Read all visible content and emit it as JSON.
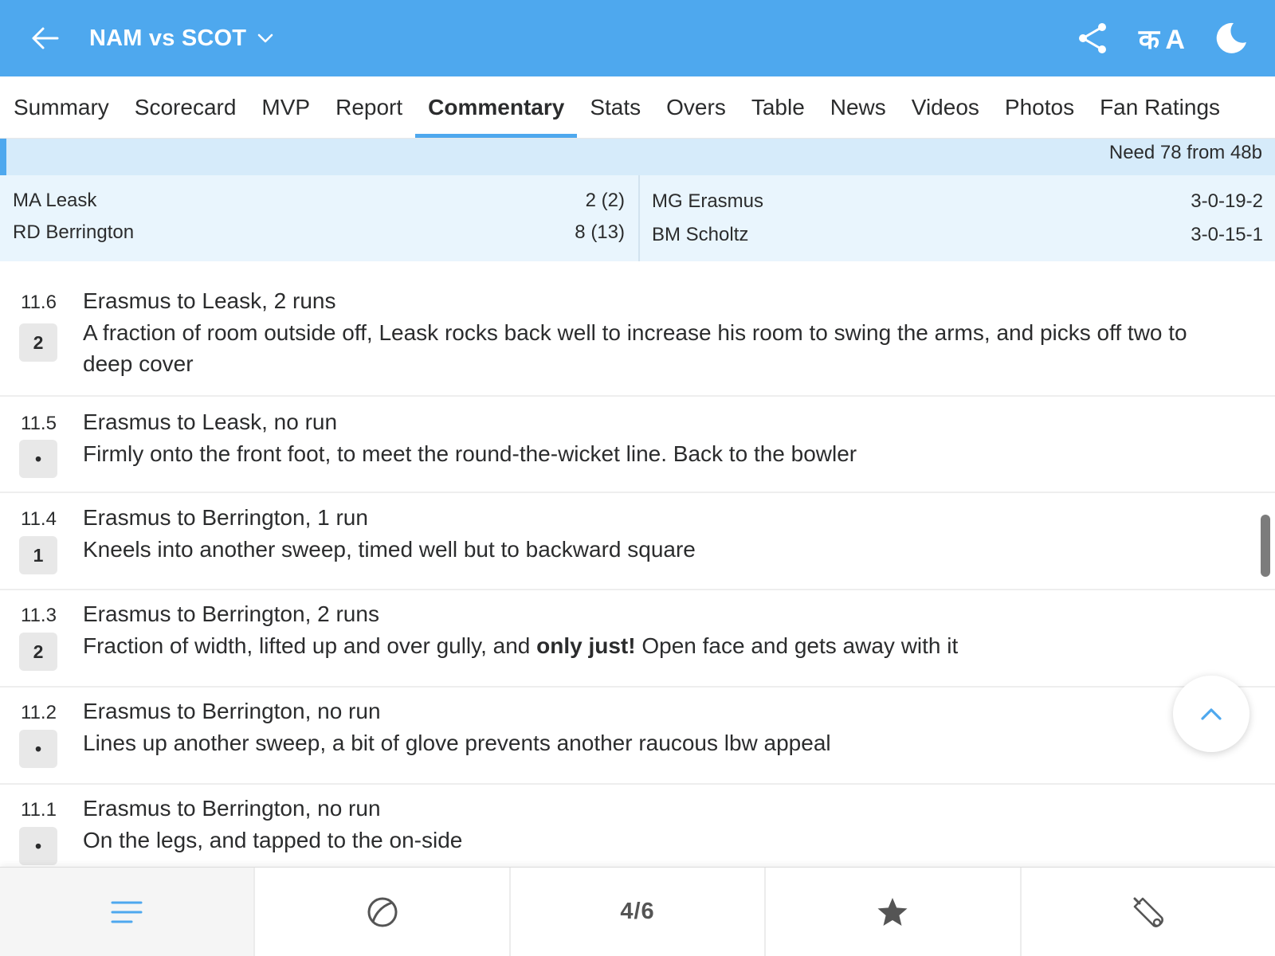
{
  "header": {
    "title": "NAM vs SCOT",
    "lang_label": "क A"
  },
  "tabs": [
    {
      "label": "Summary"
    },
    {
      "label": "Scorecard"
    },
    {
      "label": "MVP"
    },
    {
      "label": "Report"
    },
    {
      "label": "Commentary"
    },
    {
      "label": "Stats"
    },
    {
      "label": "Overs"
    },
    {
      "label": "Table"
    },
    {
      "label": "News"
    },
    {
      "label": "Videos"
    },
    {
      "label": "Photos"
    },
    {
      "label": "Fan Ratings"
    }
  ],
  "active_tab": "Commentary",
  "need": "Need 78 from 48b",
  "batters": [
    {
      "name": "MA Leask",
      "score": "2 (2)"
    },
    {
      "name": "RD Berrington",
      "score": "8 (13)"
    }
  ],
  "bowlers": [
    {
      "name": "MG Erasmus",
      "figures": "3-0-19-2"
    },
    {
      "name": "BM Scholtz",
      "figures": "3-0-15-1"
    }
  ],
  "commentary": [
    {
      "over": "11.6",
      "result": "2",
      "headline": "Erasmus to Leask, 2 runs",
      "desc": "A fraction of room outside off, Leask rocks back well to increase his room to swing the arms, and picks off two to deep cover"
    },
    {
      "over": "11.5",
      "result": "•",
      "headline": "Erasmus to Leask, no run",
      "desc": "Firmly onto the front foot, to meet the round-the-wicket line. Back to the bowler"
    },
    {
      "over": "11.4",
      "result": "1",
      "headline": "Erasmus to Berrington, 1 run",
      "desc": "Kneels into another sweep, timed well but to backward square"
    },
    {
      "over": "11.3",
      "result": "2",
      "headline": "Erasmus to Berrington, 2 runs",
      "desc_before": "Fraction of width, lifted up and over gully, and ",
      "desc_bold": "only just!",
      "desc_after": " Open face and gets away with it"
    },
    {
      "over": "11.2",
      "result": "•",
      "headline": "Erasmus to Berrington, no run",
      "desc": "Lines up another sweep, a bit of glove prevents another raucous lbw appeal"
    },
    {
      "over": "11.1",
      "result": "•",
      "headline": "Erasmus to Berrington, no run",
      "desc": "On the legs, and tapped to the on-side"
    }
  ],
  "bottom_nav": {
    "page_indicator": "4/6",
    "icons": [
      "menu-icon",
      "ball-icon",
      "star-icon",
      "bat-icon"
    ]
  },
  "colors": {
    "brand": "#4ea8ee",
    "need_bar": "#d6ebfa",
    "players_bg": "#e9f5fd",
    "badge_bg": "#e8e8e8"
  }
}
